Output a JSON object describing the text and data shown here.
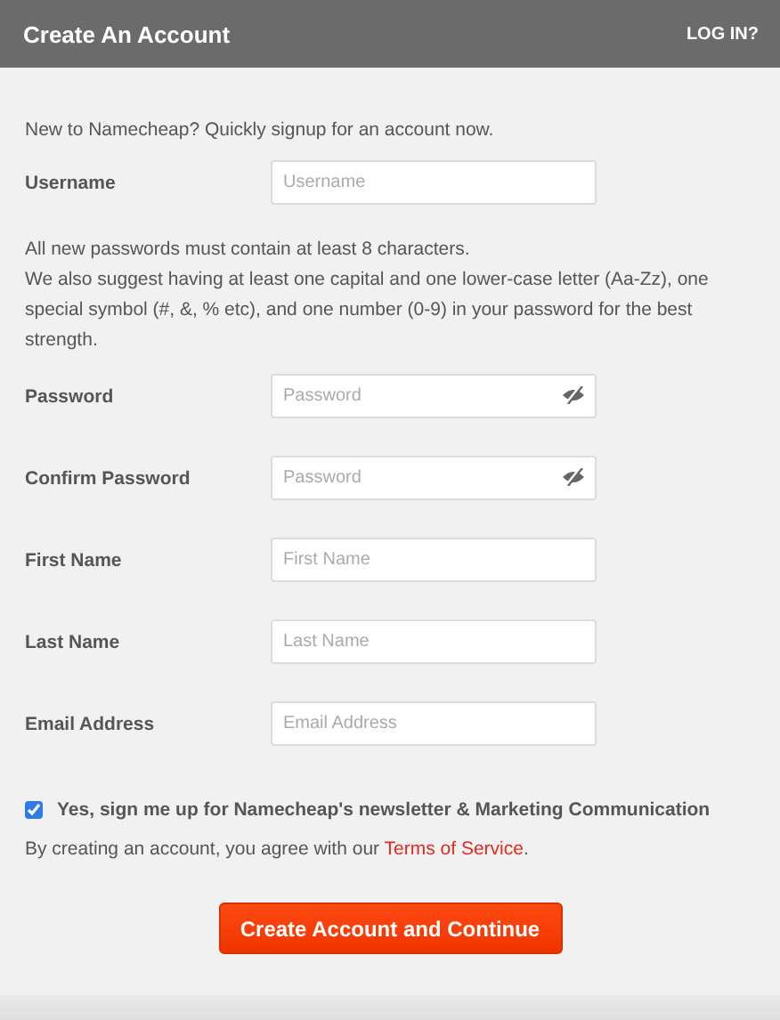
{
  "header": {
    "title": "Create An Account",
    "login_link": "LOG IN?"
  },
  "intro": "New to Namecheap? Quickly signup for an account now.",
  "fields_before": [
    {
      "label": "Username",
      "placeholder": "Username",
      "kind": "text"
    }
  ],
  "password_hint": [
    "All new passwords must contain at least 8 characters.",
    "We also suggest having at least one capital and one lower-case letter (Aa-Zz), one special symbol (#, &, % etc), and one number (0-9) in your password for the best strength."
  ],
  "fields_after": [
    {
      "label": "Password",
      "placeholder": "Password",
      "kind": "password"
    },
    {
      "label": "Confirm Password",
      "placeholder": "Password",
      "kind": "password"
    },
    {
      "label": "First Name",
      "placeholder": "First Name",
      "kind": "text"
    },
    {
      "label": "Last Name",
      "placeholder": "Last Name",
      "kind": "text"
    },
    {
      "label": "Email Address",
      "placeholder": "Email Address",
      "kind": "text"
    }
  ],
  "newsletter": {
    "label": "Yes, sign me up for Namecheap's newsletter & Marketing Communication",
    "checked": true
  },
  "terms": {
    "prefix": "By creating an account, you agree with our ",
    "link": "Terms of Service",
    "suffix": "."
  },
  "submit": "Create Account and Continue"
}
